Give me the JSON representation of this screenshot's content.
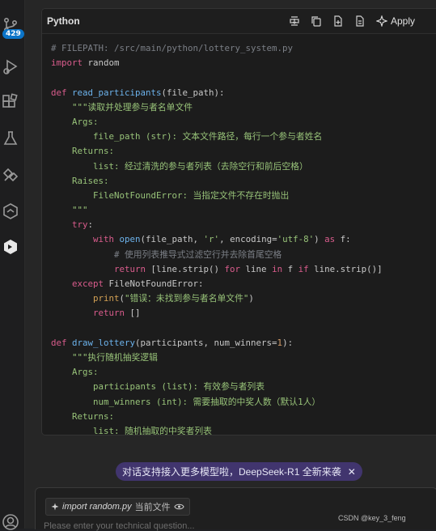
{
  "activity_bar": {
    "source_control_badge": "429",
    "icons": [
      "source-control-icon",
      "run-debug-icon",
      "extensions-icon",
      "testing-icon",
      "remote-icon",
      "docker-icon",
      "codegeex-icon",
      "account-icon"
    ]
  },
  "code_block": {
    "language": "Python",
    "apply_label": "Apply",
    "tools": [
      "insert-code-icon",
      "copy-icon",
      "new-file-icon",
      "diff-icon"
    ],
    "lines": [
      [
        {
          "t": "# FILEPATH: /src/main/python/lottery_system.py",
          "c": "cm"
        }
      ],
      [
        {
          "t": "import",
          "c": "kw"
        },
        {
          "t": " random",
          "c": ""
        }
      ],
      [],
      [
        {
          "t": "def ",
          "c": "kw"
        },
        {
          "t": "read_participants",
          "c": "fn"
        },
        {
          "t": "(file_path):",
          "c": ""
        }
      ],
      [
        {
          "t": "    \"\"\"读取并处理参与者名单文件",
          "c": "str"
        }
      ],
      [
        {
          "t": "    Args:",
          "c": "str"
        }
      ],
      [
        {
          "t": "        file_path (str): 文本文件路径，每行一个参与者姓名",
          "c": "str"
        }
      ],
      [
        {
          "t": "    Returns:",
          "c": "str"
        }
      ],
      [
        {
          "t": "        list: 经过清洗的参与者列表（去除空行和前后空格）",
          "c": "str"
        }
      ],
      [
        {
          "t": "    Raises:",
          "c": "str"
        }
      ],
      [
        {
          "t": "        FileNotFoundError: 当指定文件不存在时抛出",
          "c": "str"
        }
      ],
      [
        {
          "t": "    \"\"\"",
          "c": "str"
        }
      ],
      [
        {
          "t": "    try",
          "c": "kw"
        },
        {
          "t": ":",
          "c": ""
        }
      ],
      [
        {
          "t": "        with ",
          "c": "kw"
        },
        {
          "t": "open",
          "c": "fn"
        },
        {
          "t": "(file_path, ",
          "c": ""
        },
        {
          "t": "'r'",
          "c": "str"
        },
        {
          "t": ", encoding=",
          "c": ""
        },
        {
          "t": "'utf-8'",
          "c": "str"
        },
        {
          "t": ") ",
          "c": ""
        },
        {
          "t": "as",
          "c": "kw"
        },
        {
          "t": " f:",
          "c": ""
        }
      ],
      [
        {
          "t": "            # 使用列表推导式过滤空行并去除首尾空格",
          "c": "cm"
        }
      ],
      [
        {
          "t": "            return",
          "c": "kw"
        },
        {
          "t": " [line.strip() ",
          "c": ""
        },
        {
          "t": "for",
          "c": "kw"
        },
        {
          "t": " line ",
          "c": ""
        },
        {
          "t": "in",
          "c": "kw"
        },
        {
          "t": " f ",
          "c": ""
        },
        {
          "t": "if",
          "c": "kw"
        },
        {
          "t": " line.strip()]",
          "c": ""
        }
      ],
      [
        {
          "t": "    except ",
          "c": "kw"
        },
        {
          "t": "FileNotFoundError:",
          "c": ""
        }
      ],
      [
        {
          "t": "        print",
          "c": "bl"
        },
        {
          "t": "(",
          "c": ""
        },
        {
          "t": "\"错误：未找到参与者名单文件\"",
          "c": "str"
        },
        {
          "t": ")",
          "c": ""
        }
      ],
      [
        {
          "t": "        return",
          "c": "kw"
        },
        {
          "t": " []",
          "c": ""
        }
      ],
      [],
      [
        {
          "t": "def ",
          "c": "kw"
        },
        {
          "t": "draw_lottery",
          "c": "fn"
        },
        {
          "t": "(participants, num_winners=",
          "c": ""
        },
        {
          "t": "1",
          "c": "num"
        },
        {
          "t": "):",
          "c": ""
        }
      ],
      [
        {
          "t": "    \"\"\"执行随机抽奖逻辑",
          "c": "str"
        }
      ],
      [
        {
          "t": "    Args:",
          "c": "str"
        }
      ],
      [
        {
          "t": "        participants (list): 有效参与者列表",
          "c": "str"
        }
      ],
      [
        {
          "t": "        num_winners (int): 需要抽取的中奖人数（默认1人）",
          "c": "str"
        }
      ],
      [
        {
          "t": "    Returns:",
          "c": "str"
        }
      ],
      [
        {
          "t": "        list: 随机抽取的中奖者列表",
          "c": "str"
        }
      ]
    ]
  },
  "toast": {
    "text": "对话支持接入更多模型啦，DeepSeek-R1 全新来袭",
    "close": "✕"
  },
  "input": {
    "context_file": "import random.py",
    "context_label": "当前文件",
    "placeholder": "Please enter your technical question..."
  },
  "watermark": "CSDN @key_3_feng",
  "colors": {
    "keyword": "#d95c8c",
    "function": "#6cb2eb",
    "string": "#98c379",
    "comment": "#7b7f86",
    "badge": "#0b74c8",
    "toast_bg": "#41356e"
  }
}
